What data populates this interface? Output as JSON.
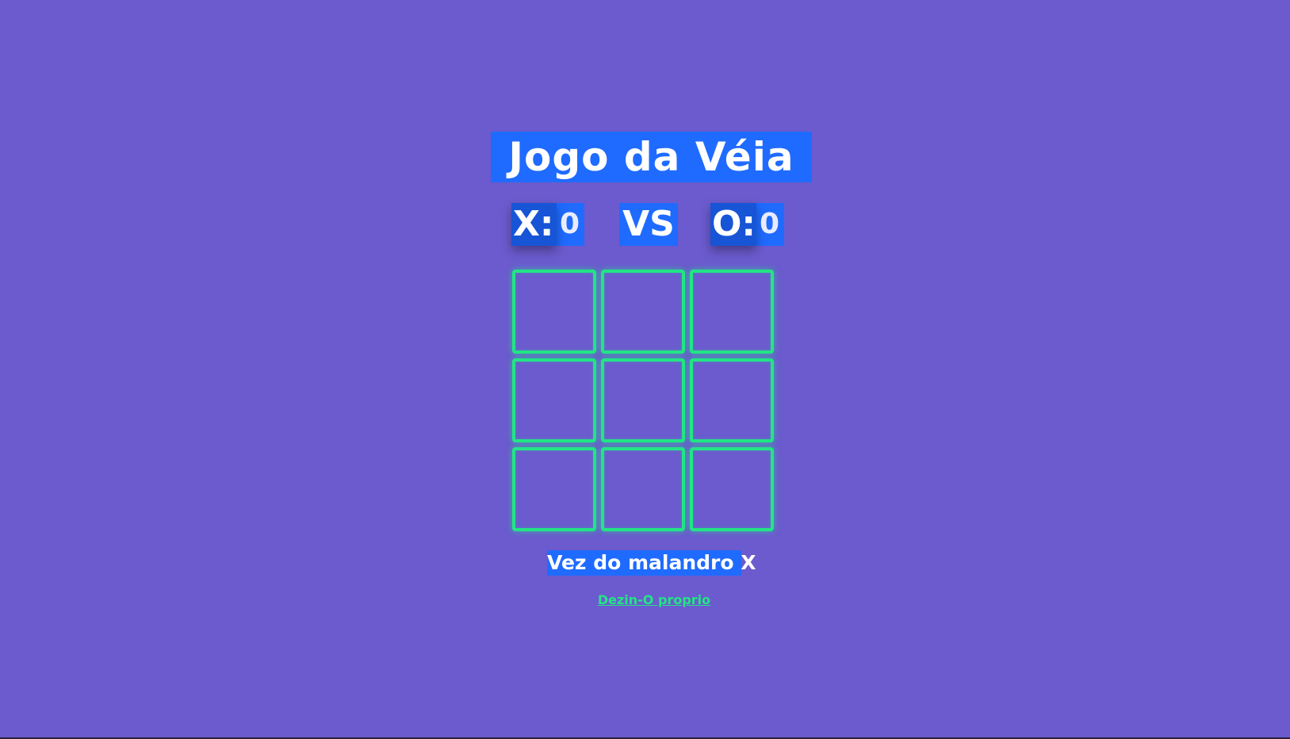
{
  "title": "Jogo da Véia",
  "scoreboard": {
    "x_label": "X:",
    "x_score": "0",
    "vs_label": "VS",
    "o_label": "O:",
    "o_score": "0"
  },
  "board": {
    "cells": [
      "",
      "",
      "",
      "",
      "",
      "",
      "",
      "",
      ""
    ]
  },
  "status": {
    "turn_text": "Vez do malandro X"
  },
  "footer": {
    "credit_link": "Dezin-O proprio"
  },
  "colors": {
    "background": "#6b5bce",
    "panel_blue": "#1f6bff",
    "neon_green": "#22e585",
    "text": "#ffffff"
  }
}
